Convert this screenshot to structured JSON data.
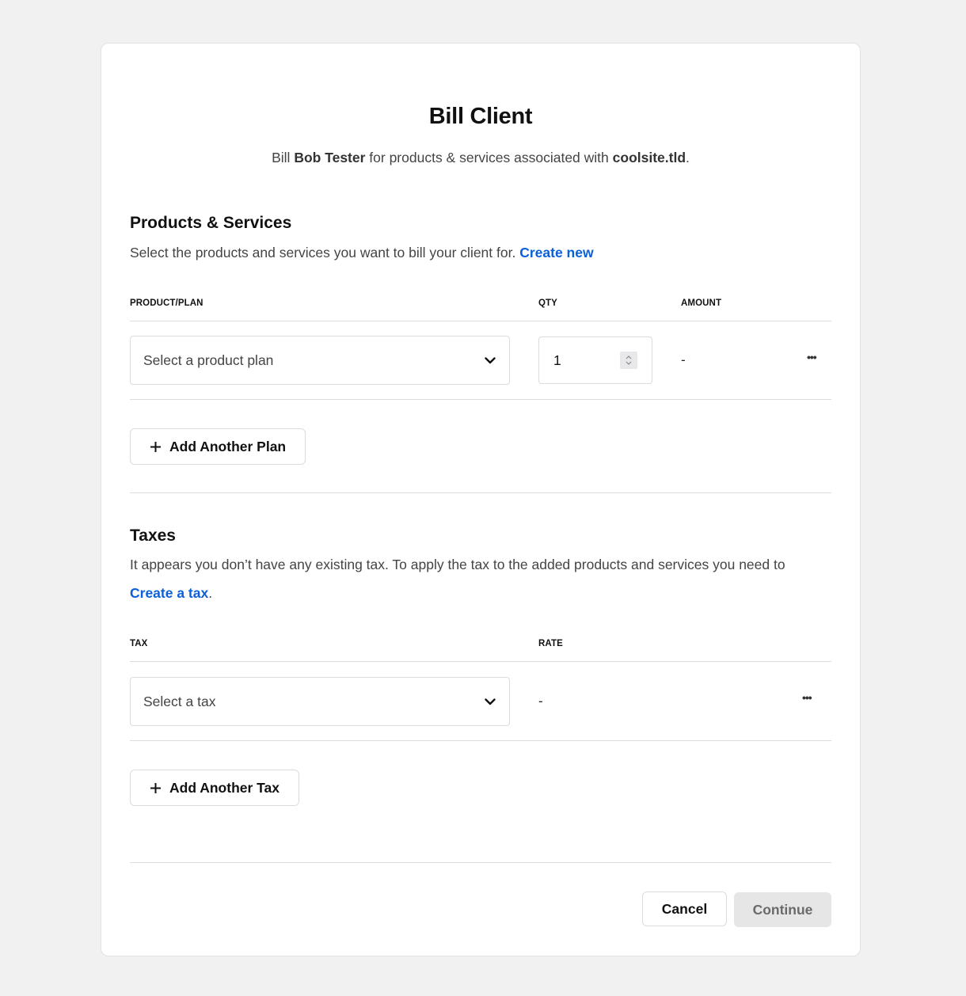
{
  "dialog": {
    "title": "Bill Client",
    "subtitle": {
      "prefix": "Bill ",
      "client_name": "Bob Tester",
      "middle": " for products & services associated with ",
      "domain": "coolsite.tld",
      "suffix": "."
    }
  },
  "products": {
    "title": "Products & Services",
    "description": "Select the products and services you want to bill your client for. ",
    "create_link": "Create new",
    "columns": {
      "product": "PRODUCT/PLAN",
      "qty": "QTY",
      "amount": "AMOUNT"
    },
    "rows": [
      {
        "plan_placeholder": "Select a product plan",
        "qty": "1",
        "amount": "-",
        "more_icon": "ellipsis-icon"
      }
    ],
    "add_button": "Add Another Plan"
  },
  "taxes": {
    "title": "Taxes",
    "description": "It appears you don’t have any existing tax. To apply the tax to the added products and services you need to",
    "create_link": "Create a tax",
    "create_suffix": ".",
    "columns": {
      "tax": "TAX",
      "rate": "RATE"
    },
    "rows": [
      {
        "tax_placeholder": "Select a tax",
        "rate": "-",
        "more_icon": "ellipsis-icon"
      }
    ],
    "add_button": "Add Another Tax"
  },
  "footer": {
    "cancel": "Cancel",
    "continue": "Continue"
  },
  "colors": {
    "link": "#0b5fd9",
    "page_bg": "#f1f1f1",
    "disabled_button_bg": "#e6e6e6"
  }
}
